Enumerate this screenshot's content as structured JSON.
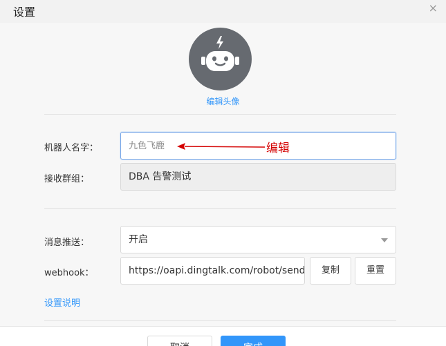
{
  "dialog": {
    "title": "设置",
    "close_glyph": "×"
  },
  "avatar": {
    "icon": "robot-icon",
    "edit_label": "编辑头像"
  },
  "form": {
    "robot_name_label": "机器人名字：",
    "robot_name_value": "九色飞鹿",
    "group_label": "接收群组：",
    "group_value": "DBA 告警测试",
    "push_label": "消息推送：",
    "push_value": "开启",
    "webhook_label": "webhook：",
    "webhook_value": "https://oapi.dingtalk.com/robot/send",
    "copy_label": "复制",
    "reset_label": "重置",
    "help_link": "设置说明"
  },
  "annotation": {
    "text": "编辑",
    "color": "#d40000"
  },
  "footer": {
    "cancel_label": "取消",
    "ok_label": "完成"
  },
  "colors": {
    "accent": "#3296fa",
    "avatar_bg": "#666a70"
  }
}
